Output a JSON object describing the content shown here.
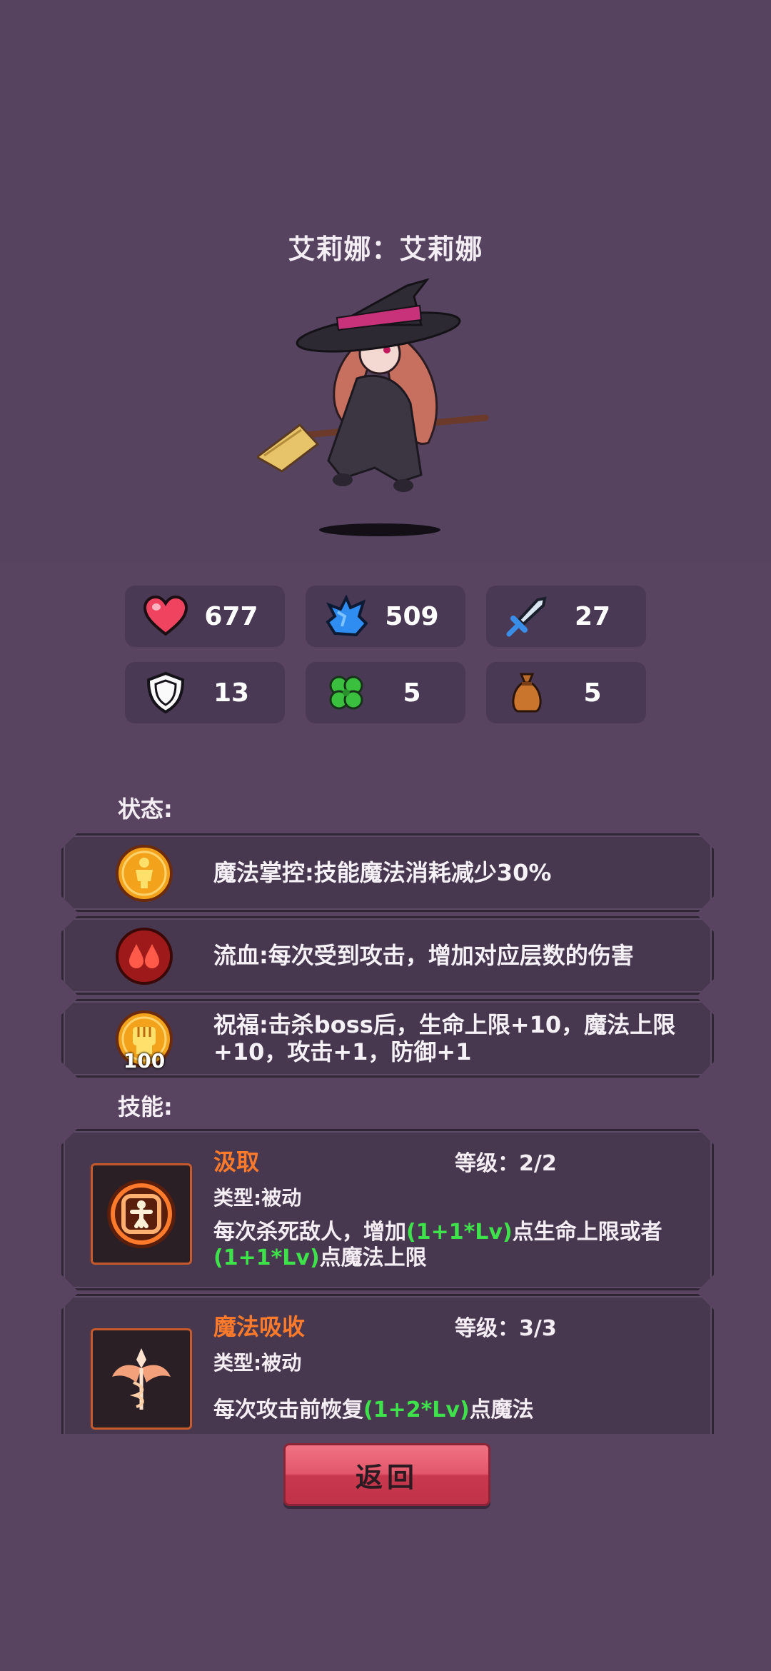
{
  "character": {
    "title": "艾莉娜：艾莉娜"
  },
  "stats": [
    {
      "icon": "heart-icon",
      "value": "677"
    },
    {
      "icon": "mana-crystal-icon",
      "value": "509"
    },
    {
      "icon": "sword-icon",
      "value": "27"
    },
    {
      "icon": "shield-icon",
      "value": "13"
    },
    {
      "icon": "clover-icon",
      "value": "5"
    },
    {
      "icon": "money-bag-icon",
      "value": "5"
    }
  ],
  "status": {
    "label": "状态:",
    "items": [
      {
        "icon": "magic-mastery-icon",
        "text": "魔法掌控:技能魔法消耗减少30%"
      },
      {
        "icon": "bleed-icon",
        "text": "流血:每次受到攻击，增加对应层数的伤害"
      },
      {
        "icon": "blessing-fist-icon",
        "text": "祝福:击杀boss后，生命上限+10，魔法上限+10，攻击+1，防御+1",
        "badge": "100"
      }
    ]
  },
  "skills": {
    "label": "技能:",
    "items": [
      {
        "name": "汲取",
        "level": "等级：2/2",
        "type": "类型:被动",
        "desc_1": "每次杀死敌人，增加",
        "desc_2": "(1+1*Lv)",
        "desc_3": "点生命上限或者",
        "desc_4": "(1+1*Lv)",
        "desc_5": "点魔法上限"
      },
      {
        "name": "魔法吸收",
        "level": "等级：3/3",
        "type": "类型:被动",
        "desc_1": "每次攻击前恢复",
        "desc_2": "(1+2*Lv)",
        "desc_3": "点魔法"
      }
    ]
  },
  "back_button": {
    "label": "返回"
  },
  "colors": {
    "background": "#584461",
    "accent_orange": "#ff7a2a",
    "highlight_green": "#3ee24a",
    "button_red": "#e2576b"
  }
}
